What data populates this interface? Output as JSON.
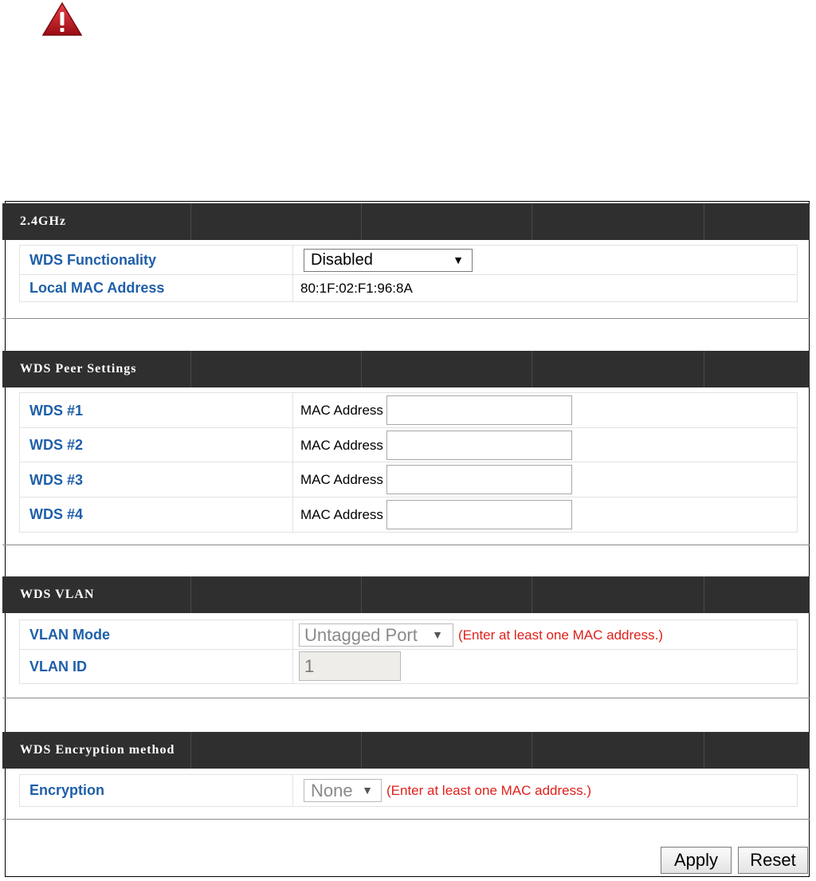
{
  "sections": {
    "band": {
      "title": "2.4GHz",
      "rows": {
        "wds_functionality": {
          "label": "WDS Functionality",
          "value": "Disabled"
        },
        "local_mac": {
          "label": "Local MAC Address",
          "value": "80:1F:02:F1:96:8A"
        }
      }
    },
    "peers": {
      "title": "WDS Peer Settings",
      "mac_label": "MAC Address",
      "rows": [
        {
          "label": "WDS #1",
          "value": ""
        },
        {
          "label": "WDS #2",
          "value": ""
        },
        {
          "label": "WDS #3",
          "value": ""
        },
        {
          "label": "WDS #4",
          "value": ""
        }
      ]
    },
    "vlan": {
      "title": "WDS VLAN",
      "mode_label": "VLAN Mode",
      "mode_value": "Untagged Port",
      "id_label": "VLAN ID",
      "id_value": "1",
      "hint": "(Enter at least one MAC address.)"
    },
    "encryption": {
      "title": "WDS Encryption method",
      "label": "Encryption",
      "value": "None",
      "hint": "(Enter at least one MAC address.)"
    }
  },
  "buttons": {
    "apply": "Apply",
    "reset": "Reset"
  },
  "icons": {
    "warning": "warning-triangle-icon",
    "dropdown": "chevron-down-icon"
  },
  "colors": {
    "header_bg": "#2f2f2f",
    "label": "#1f5fa8",
    "hint": "#e0201b",
    "warning": "#c8141a"
  }
}
